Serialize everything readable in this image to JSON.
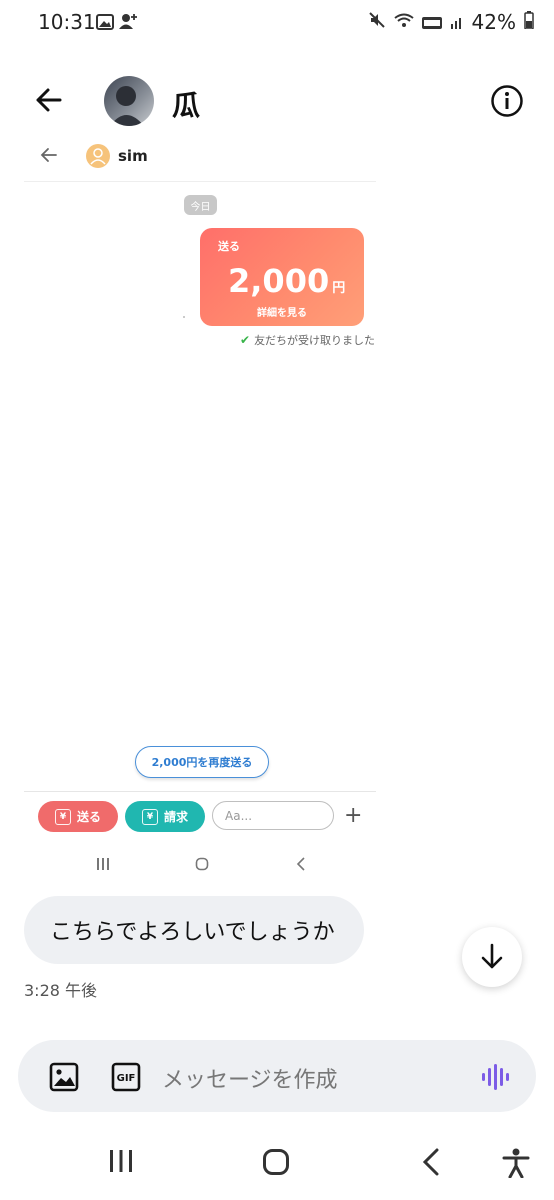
{
  "status": {
    "time": "10:31",
    "battery": "42%"
  },
  "header": {
    "title": "瓜"
  },
  "inner": {
    "name": "sim",
    "date_chip": "今日",
    "card": {
      "label": "送る",
      "amount": "2,000",
      "unit": "円",
      "link": "詳細を見る"
    },
    "received": "友だちが受け取りました",
    "resend": "2,000円を再度送る",
    "send": "送る",
    "request": "請求",
    "yen": "¥",
    "input_placeholder": "Aa..."
  },
  "chat": {
    "message": "こちらでよろしいでしょうか",
    "timestamp": "3:28 午後"
  },
  "composer": {
    "placeholder": "メッセージを作成"
  },
  "colors": {
    "accent_voice": "#7c5ce6",
    "send": "#f06b6b",
    "request": "#20b7b0"
  },
  "icons": [
    "back-arrow-icon",
    "info-icon",
    "image-icon",
    "gif-icon",
    "voice-icon",
    "scroll-down-icon",
    "recent-apps-icon",
    "home-icon",
    "nav-back-icon",
    "accessibility-icon"
  ]
}
